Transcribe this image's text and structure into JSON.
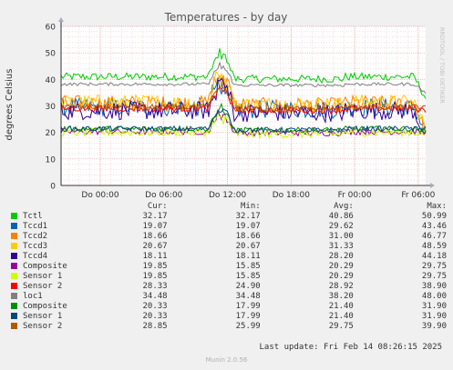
{
  "chart_data": {
    "type": "line",
    "title": "Temperatures - by day",
    "ylabel": "degrees Celsius",
    "watermark": "RRDTOOL / TOBI OETIKER",
    "ylim": [
      0,
      60
    ],
    "yticks": [
      "0",
      "10",
      "20",
      "30",
      "40",
      "50",
      "60"
    ],
    "xticks": [
      "Do 00:00",
      "Do 06:00",
      "Do 12:00",
      "Do 18:00",
      "Fr 00:00",
      "Fr 06:00"
    ],
    "xlim_hours": [
      -3.7,
      30.7
    ],
    "xtick_hours": [
      0,
      6,
      12,
      18,
      24,
      30
    ],
    "grid": true,
    "legend_headers": [
      "Cur:",
      "Min:",
      "Avg:",
      "Max:"
    ],
    "series": [
      {
        "name": "Tctl",
        "color": "#00cc00",
        "cur": "32.17",
        "min": "32.17",
        "avg": "40.86",
        "max": "50.99",
        "base": 41,
        "noise": 1.5,
        "ampl": 1.0,
        "peak": 10
      },
      {
        "name": "Tccd1",
        "color": "#0066b3",
        "cur": "19.07",
        "min": "19.07",
        "avg": "29.62",
        "max": "43.46",
        "base": 29.5,
        "noise": 3.5,
        "ampl": 1.0,
        "peak": 12
      },
      {
        "name": "Tccd2",
        "color": "#ff8000",
        "cur": "18.66",
        "min": "18.66",
        "avg": "31.00",
        "max": "46.77",
        "base": 31,
        "noise": 3.0,
        "ampl": 1.0,
        "peak": 13
      },
      {
        "name": "Tccd3",
        "color": "#ffcc00",
        "cur": "20.67",
        "min": "20.67",
        "avg": "31.33",
        "max": "48.59",
        "base": 31.3,
        "noise": 3.0,
        "ampl": 1.0,
        "peak": 14
      },
      {
        "name": "Tccd4",
        "color": "#330099",
        "cur": "18.11",
        "min": "18.11",
        "avg": "28.20",
        "max": "44.18",
        "base": 28.2,
        "noise": 3.5,
        "ampl": 1.0,
        "peak": 13
      },
      {
        "name": "Composite",
        "color": "#990099",
        "cur": "19.85",
        "min": "15.85",
        "avg": "20.29",
        "max": "29.75",
        "base": 20.3,
        "noise": 1.2,
        "ampl": 0.6,
        "peak": 8
      },
      {
        "name": "Sensor 1",
        "color": "#ccff00",
        "cur": "19.85",
        "min": "15.85",
        "avg": "20.29",
        "max": "29.75",
        "base": 20,
        "noise": 1.5,
        "ampl": 0.8,
        "peak": 7
      },
      {
        "name": "Sensor 2",
        "color": "#ff0000",
        "cur": "28.33",
        "min": "24.90",
        "avg": "28.92",
        "max": "38.90",
        "base": 29,
        "noise": 1.2,
        "ampl": 0.8,
        "peak": 9
      },
      {
        "name": "loc1",
        "color": "#808080",
        "cur": "34.48",
        "min": "34.48",
        "avg": "38.20",
        "max": "48.00",
        "base": 38.2,
        "noise": 0.6,
        "ampl": 0.5,
        "peak": 8
      },
      {
        "name": "Composite",
        "color": "#008f00",
        "cur": "20.33",
        "min": "17.99",
        "avg": "21.40",
        "max": "31.90",
        "base": 21.4,
        "noise": 1.0,
        "ampl": 0.6,
        "peak": 9
      },
      {
        "name": "Sensor 1",
        "color": "#00487d",
        "cur": "20.33",
        "min": "17.99",
        "avg": "21.40",
        "max": "31.90",
        "base": 21.4,
        "noise": 1.0,
        "ampl": 0.6,
        "peak": 9
      },
      {
        "name": "Sensor 2",
        "color": "#b35a00",
        "cur": "28.85",
        "min": "25.99",
        "avg": "29.75",
        "max": "39.90",
        "base": 29.5,
        "noise": 1.2,
        "ampl": 0.8,
        "peak": 9
      }
    ]
  },
  "footer": {
    "last_update": "Last update: Fri Feb 14 08:26:15 2025",
    "munin_version": "Munin 2.0.56"
  }
}
